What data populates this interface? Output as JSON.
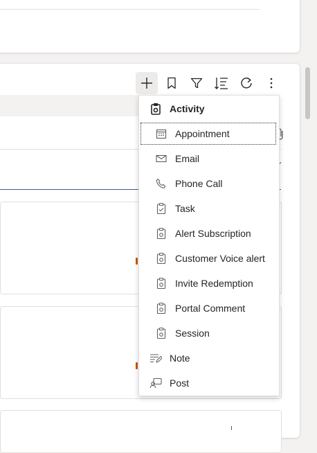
{
  "toolbar": {
    "buttons": [
      {
        "name": "add-icon"
      },
      {
        "name": "bookmark-icon"
      },
      {
        "name": "filter-icon"
      },
      {
        "name": "sort-icon"
      },
      {
        "name": "refresh-icon"
      },
      {
        "name": "more-icon"
      }
    ]
  },
  "menu": {
    "header": "Activity",
    "items": [
      {
        "label": "Appointment",
        "icon": "calendar-icon"
      },
      {
        "label": "Email",
        "icon": "mail-icon"
      },
      {
        "label": "Phone Call",
        "icon": "phone-icon"
      },
      {
        "label": "Task",
        "icon": "task-icon"
      },
      {
        "label": "Alert Subscription",
        "icon": "clipboard-activity-icon"
      },
      {
        "label": "Customer Voice alert",
        "icon": "clipboard-activity-icon"
      },
      {
        "label": "Invite Redemption",
        "icon": "clipboard-activity-icon"
      },
      {
        "label": "Portal Comment",
        "icon": "clipboard-activity-icon"
      },
      {
        "label": "Session",
        "icon": "clipboard-activity-icon"
      },
      {
        "label": "Note",
        "icon": "note-icon"
      },
      {
        "label": "Post",
        "icon": "post-icon"
      }
    ]
  },
  "colors": {
    "accent_line": "#3a5a8c",
    "status_mark": "#c05a00"
  }
}
